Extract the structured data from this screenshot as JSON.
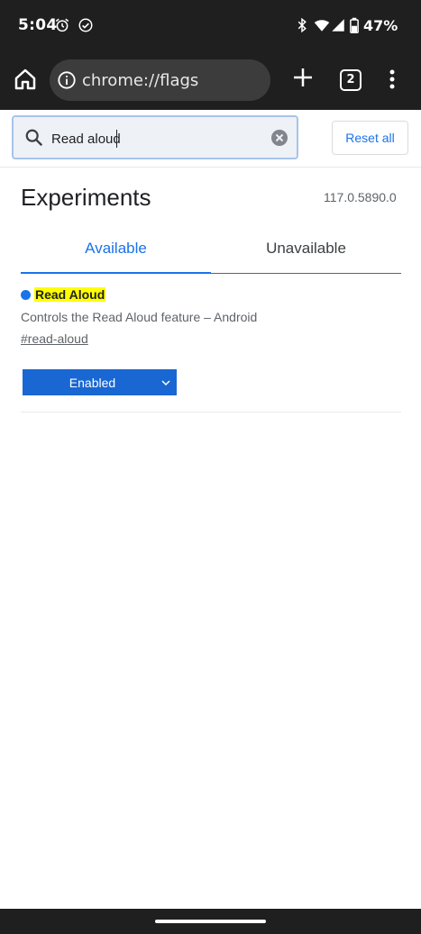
{
  "status_bar": {
    "time": "5:04",
    "battery_percent": "47%",
    "icons": [
      "alarm-icon",
      "check-circle-icon",
      "bluetooth-icon",
      "wifi-icon",
      "signal-icon",
      "battery-icon"
    ]
  },
  "toolbar": {
    "url": "chrome://flags",
    "tab_count": "2",
    "icons": [
      "home-icon",
      "info-icon",
      "plus-icon",
      "tabs-icon",
      "more-vert-icon"
    ]
  },
  "search": {
    "value": "Read aloud",
    "reset_label": "Reset all"
  },
  "header": {
    "title": "Experiments",
    "version": "117.0.5890.0"
  },
  "tabs": [
    {
      "label": "Available",
      "selected": true
    },
    {
      "label": "Unavailable",
      "selected": false
    }
  ],
  "flags": [
    {
      "name": "Read Aloud",
      "description": "Controls the Read Aloud feature – Android",
      "link": "#read-aloud",
      "state": "Enabled"
    }
  ],
  "colors": {
    "accent": "#1a73e8",
    "highlight": "#ffff00",
    "select_bg": "#1967d2",
    "bars": "#1f1f1f"
  }
}
